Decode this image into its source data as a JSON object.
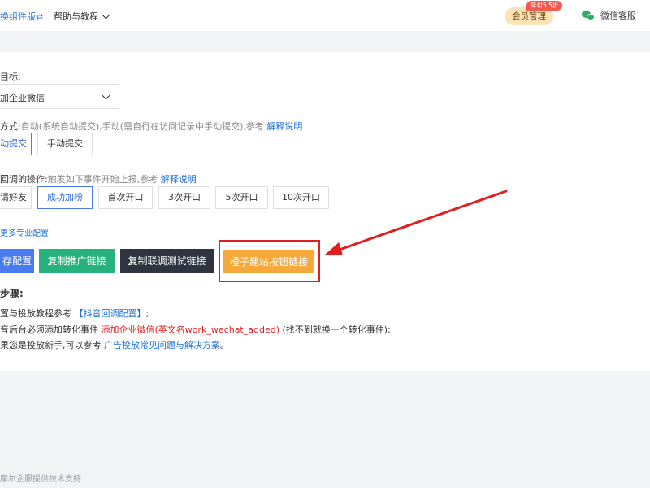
{
  "topbar": {
    "switch_label": "换组件版⇄",
    "help_menu": "帮助与教程",
    "vip_badge": "年付5.5折",
    "vip_button": "会员管理",
    "wechat_service": "微信客服"
  },
  "target": {
    "label": "目标:",
    "selected": "加企业微信"
  },
  "mode": {
    "label": "方式:",
    "description": "自动(系统自动提交),手动(需自行在访问记录中手动提交),参考",
    "explain_link": "解释说明",
    "options": [
      "动提交",
      "手动提交"
    ]
  },
  "callback": {
    "label": "回调的操作:",
    "description": "触发如下事件开始上报,参考",
    "explain_link": "解释说明",
    "options": [
      "请好友",
      "成功加粉",
      "首次开口",
      "3次开口",
      "5次开口",
      "10次开口"
    ]
  },
  "more_config_link": "更多专业配置",
  "buttons": {
    "save": "存配置",
    "copy_promo": "复制推广链接",
    "copy_joint": "复制联调测试链接",
    "orange_link": "橙子建站按钮链接"
  },
  "steps": {
    "title": "步骤:",
    "line1_a": "置与投放教程参考",
    "line1_link": "【抖音回调配置】",
    "line1_b": ";",
    "line2_a": "音后台必须添加转化事件",
    "line2_red": "添加企业微信(英文名work_wechat_added)",
    "line2_b": "(找不到就换一个转化事件);",
    "line3_a": "果您是投放新手,可以参考",
    "line3_link": "广告投放常见问题与解决方案",
    "line3_b": "。"
  },
  "footer": "摩尔企服提供技术支持",
  "colors": {
    "primary": "#4a7cf0",
    "green": "#26b17e",
    "dark": "#2f3440",
    "orange": "#f5a93a",
    "annotation_red": "#e01e1e"
  }
}
